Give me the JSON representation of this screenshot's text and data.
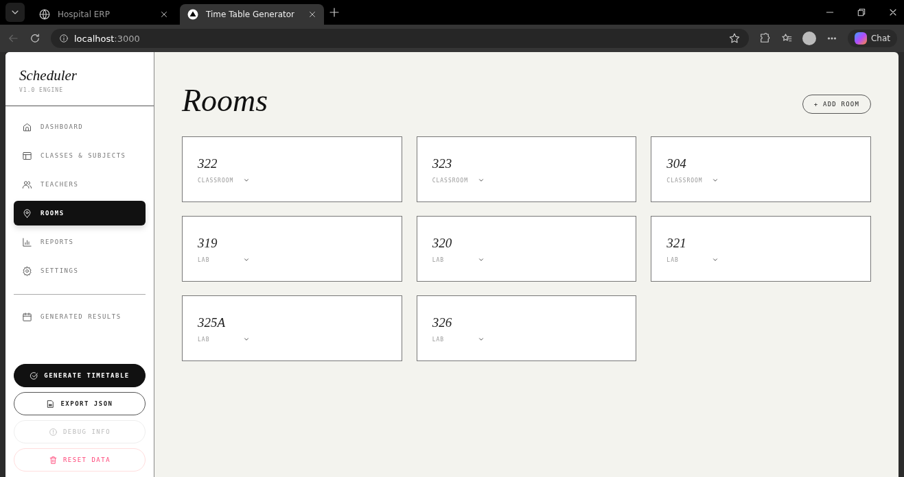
{
  "browser": {
    "tabs": [
      {
        "title": "Hospital ERP",
        "selected": false
      },
      {
        "title": "Time Table Generator",
        "selected": true
      }
    ],
    "address": {
      "host": "localhost",
      "port": ":3000"
    },
    "chat_label": "Chat"
  },
  "sidebar": {
    "brand": "Scheduler",
    "version": "V1.0 ENGINE",
    "items": [
      {
        "label": "DASHBOARD",
        "selected": false
      },
      {
        "label": "CLASSES & SUBJECTS",
        "selected": false
      },
      {
        "label": "TEACHERS",
        "selected": false
      },
      {
        "label": "ROOMS",
        "selected": true
      },
      {
        "label": "REPORTS",
        "selected": false
      },
      {
        "label": "SETTINGS",
        "selected": false
      }
    ],
    "secondary_items": [
      {
        "label": "GENERATED RESULTS",
        "selected": false
      }
    ],
    "actions": [
      {
        "label": "GENERATE TIMETABLE",
        "kind": "primary"
      },
      {
        "label": "EXPORT JSON",
        "kind": "outline"
      },
      {
        "label": "DEBUG INFO",
        "kind": "muted"
      },
      {
        "label": "RESET DATA",
        "kind": "danger"
      }
    ]
  },
  "main": {
    "title": "Rooms",
    "add_button": "+ ADD ROOM",
    "rooms": [
      {
        "name": "322",
        "type": "CLASSROOM"
      },
      {
        "name": "323",
        "type": "CLASSROOM"
      },
      {
        "name": "304",
        "type": "CLASSROOM"
      },
      {
        "name": "319",
        "type": "LAB"
      },
      {
        "name": "320",
        "type": "LAB"
      },
      {
        "name": "321",
        "type": "LAB"
      },
      {
        "name": "325A",
        "type": "LAB"
      },
      {
        "name": "326",
        "type": "LAB"
      }
    ]
  }
}
